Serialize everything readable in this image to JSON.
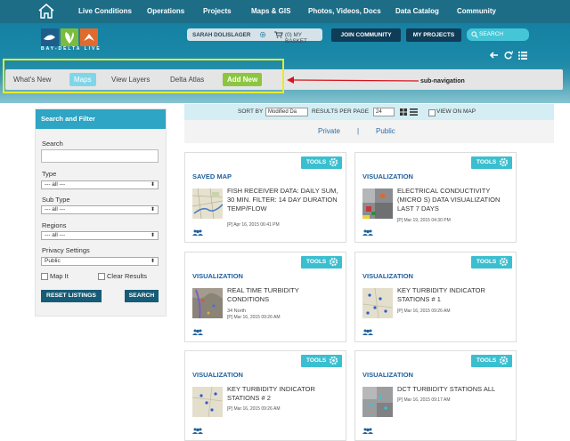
{
  "topnav": {
    "items": [
      "Live Conditions",
      "Operations",
      "Projects",
      "Maps & GIS",
      "Photos, Videos, Docs",
      "Data Catalog",
      "Community"
    ]
  },
  "header": {
    "logo_text": "BAY-DELTA LIVE",
    "user_name": "SARAH DOLISLAGER",
    "basket_label": "(0) MY BASKET",
    "join_label": "JOIN COMMUNITY",
    "projects_label": "MY PROJECTS",
    "search_placeholder": "SEARCH"
  },
  "subnav": {
    "items": [
      "What's New",
      "Maps",
      "View Layers",
      "Delta Atlas",
      "Add New"
    ],
    "active": "Maps",
    "annotation": "sub-navigation"
  },
  "sidebar": {
    "title": "Search and Filter",
    "search_label": "Search",
    "search_value": "",
    "type_label": "Type",
    "type_value": "--- all ---",
    "subtype_label": "Sub Type",
    "subtype_value": "--- all ---",
    "regions_label": "Regions",
    "regions_value": "--- all ---",
    "privacy_label": "Privacy Settings",
    "privacy_value": "Public",
    "mapit_label": "Map It",
    "clear_label": "Clear Results",
    "reset_label": "RESET LISTINGS",
    "search_button": "SEARCH"
  },
  "toolbar": {
    "sort_label": "SORT BY",
    "sort_value": "Modified Da",
    "per_page_label": "RESULTS PER PAGE",
    "per_page_value": "24",
    "view_on_map": "VIEW ON MAP"
  },
  "tabs": {
    "private": "Private",
    "separator": "|",
    "public": "Public"
  },
  "cards": [
    {
      "tools": "TOOLS",
      "type": "SAVED MAP",
      "title": "FISH RECEIVER DATA: DAILY SUM, 30 MIN. FILTER: 14 DAY DURATION TEMP/FLOW",
      "sub": "",
      "date": "[P] Apr 16, 2015 06:41 PM"
    },
    {
      "tools": "TOOLS",
      "type": "VISUALIZATION",
      "title": "ELECTRICAL CONDUCTIVITY (MICRO S) DATA VISUALIZATION LAST 7 DAYS",
      "sub": "",
      "date": "[P] Mar 19, 2015 04:30 PM"
    },
    {
      "tools": "TOOLS",
      "type": "VISUALIZATION",
      "title": "REAL TIME TURBIDITY CONDITIONS",
      "sub": "34 North",
      "date": "[P] Mar 16, 2015 09:26 AM"
    },
    {
      "tools": "TOOLS",
      "type": "VISUALIZATION",
      "title": "KEY TURBIDITY INDICATOR STATIONS # 1",
      "sub": "",
      "date": "[P] Mar 16, 2015 09:26 AM"
    },
    {
      "tools": "TOOLS",
      "type": "VISUALIZATION",
      "title": "KEY TURBIDITY INDICATOR STATIONS # 2",
      "sub": "",
      "date": "[P] Mar 16, 2015 09:26 AM"
    },
    {
      "tools": "TOOLS",
      "type": "VISUALIZATION",
      "title": "DCT TURBIDITY STATIONS ALL",
      "sub": "",
      "date": "[P] Mar 16, 2015 09:17 AM"
    }
  ]
}
